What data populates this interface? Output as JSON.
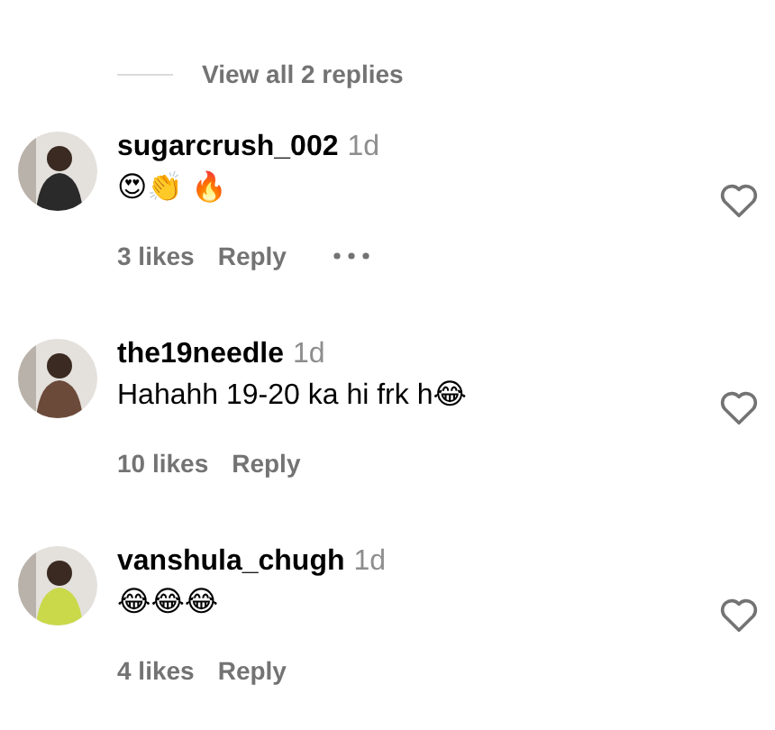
{
  "view_replies": {
    "text": "View all 2 replies"
  },
  "comments": [
    {
      "username": "sugarcrush_002",
      "time": "1d",
      "text": "😍👏 🔥",
      "likes": "3 likes",
      "reply": "Reply",
      "show_more": true,
      "liked": false
    },
    {
      "username": "the19needle",
      "time": "1d",
      "text": "Hahahh 19-20 ka hi frk h😂",
      "likes": "10 likes",
      "reply": "Reply",
      "show_more": false,
      "liked": false
    },
    {
      "username": "vanshula_chugh",
      "time": "1d",
      "text": "😂😂😂",
      "likes": "4 likes",
      "reply": "Reply",
      "show_more": false,
      "liked": false
    }
  ]
}
